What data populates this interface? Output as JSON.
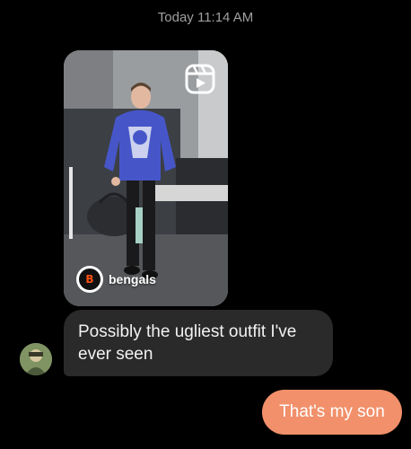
{
  "chat": {
    "timestamp": "Today 11:14 AM"
  },
  "shared_reel": {
    "account_logo_text": "B",
    "account_name": "bengals",
    "icon": "reels-icon"
  },
  "messages": [
    {
      "direction": "incoming",
      "text": "Possibly the ugliest outfit I've ever seen"
    },
    {
      "direction": "outgoing",
      "text": "That's my son"
    }
  ],
  "colors": {
    "background": "#000000",
    "incoming_bubble": "#2a2a2a",
    "outgoing_bubble": "#f1906a",
    "timestamp_text": "#a0a0a0"
  }
}
